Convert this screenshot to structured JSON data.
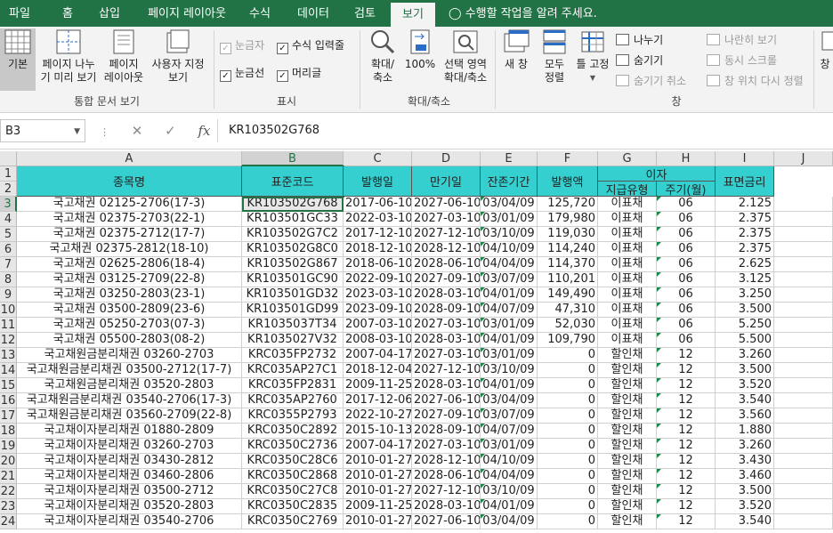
{
  "ribbon_tabs": [
    "파일",
    "홈",
    "삽입",
    "페이지 레이아웃",
    "수식",
    "데이터",
    "검토",
    "보기"
  ],
  "active_tab": "보기",
  "tell_me": "수행할 작업을 알려 주세요.",
  "ribbon": {
    "views": {
      "normal": "기본",
      "page_break": [
        "페이지 나누",
        "기 미리 보기"
      ],
      "page_layout": [
        "페이지",
        "레이아웃"
      ],
      "custom": [
        "사용자 지정",
        "보기"
      ],
      "label": "통합 문서 보기"
    },
    "show": {
      "ruler": "눈금자",
      "formula_bar": "수식 입력줄",
      "gridlines": "눈금선",
      "headings": "머리글",
      "label": "표시"
    },
    "zoom": {
      "zoom": [
        "확대/",
        "축소"
      ],
      "zoom100": "100%",
      "zoom_sel": [
        "선택 영역",
        "확대/축소"
      ],
      "label": "확대/축소"
    },
    "window": {
      "new_window": "새 창",
      "arrange_all": [
        "모두",
        "정렬"
      ],
      "freeze": "틀 고정",
      "split": "나누기",
      "hide": "숨기기",
      "unhide": "숨기기 취소",
      "side_by_side": "나란히 보기",
      "sync_scroll": "동시 스크롤",
      "reset_pos": "창 위치 다시 정렬",
      "switch": "창",
      "label": "창"
    }
  },
  "formula_bar": {
    "name_box": "B3",
    "formula": "KR103502G768"
  },
  "columns": [
    "A",
    "B",
    "C",
    "D",
    "E",
    "F",
    "G",
    "H",
    "I",
    "J"
  ],
  "headers": {
    "A": "종목명",
    "B": "표준코드",
    "C": "발행일",
    "D": "만기일",
    "E": "잔존기간",
    "F": "발행액",
    "interest": "이자",
    "G": "지급유형",
    "H": "주기(월)",
    "I": "표면금리"
  },
  "rows": [
    {
      "n": "3",
      "a": "국고채권 02125-2706(17-3)",
      "b": "KR103502G768",
      "c": "2017-06-10",
      "d": "2027-06-10",
      "e": "03/04/09",
      "f": "125,720",
      "g": "이표채",
      "h": "06",
      "i": "2.125"
    },
    {
      "n": "4",
      "a": "국고채권 02375-2703(22-1)",
      "b": "KR103501GC33",
      "c": "2022-03-10",
      "d": "2027-03-10",
      "e": "03/01/09",
      "f": "179,980",
      "g": "이표채",
      "h": "06",
      "i": "2.375"
    },
    {
      "n": "5",
      "a": "국고채권 02375-2712(17-7)",
      "b": "KR103502G7C2",
      "c": "2017-12-10",
      "d": "2027-12-10",
      "e": "03/10/09",
      "f": "119,030",
      "g": "이표채",
      "h": "06",
      "i": "2.375"
    },
    {
      "n": "6",
      "a": "국고채권 02375-2812(18-10)",
      "b": "KR103502G8C0",
      "c": "2018-12-10",
      "d": "2028-12-10",
      "e": "04/10/09",
      "f": "114,240",
      "g": "이표채",
      "h": "06",
      "i": "2.375"
    },
    {
      "n": "7",
      "a": "국고채권 02625-2806(18-4)",
      "b": "KR103502G867",
      "c": "2018-06-10",
      "d": "2028-06-10",
      "e": "04/04/09",
      "f": "114,370",
      "g": "이표채",
      "h": "06",
      "i": "2.625"
    },
    {
      "n": "8",
      "a": "국고채권 03125-2709(22-8)",
      "b": "KR103501GC90",
      "c": "2022-09-10",
      "d": "2027-09-10",
      "e": "03/07/09",
      "f": "110,201",
      "g": "이표채",
      "h": "06",
      "i": "3.125"
    },
    {
      "n": "9",
      "a": "국고채권 03250-2803(23-1)",
      "b": "KR103501GD32",
      "c": "2023-03-10",
      "d": "2028-03-10",
      "e": "04/01/09",
      "f": "149,490",
      "g": "이표채",
      "h": "06",
      "i": "3.250"
    },
    {
      "n": "10",
      "a": "국고채권 03500-2809(23-6)",
      "b": "KR103501GD99",
      "c": "2023-09-10",
      "d": "2028-09-10",
      "e": "04/07/09",
      "f": "47,310",
      "g": "이표채",
      "h": "06",
      "i": "3.500"
    },
    {
      "n": "11",
      "a": "국고채권 05250-2703(07-3)",
      "b": "KR1035037T34",
      "c": "2007-03-10",
      "d": "2027-03-10",
      "e": "03/01/09",
      "f": "52,030",
      "g": "이표채",
      "h": "06",
      "i": "5.250"
    },
    {
      "n": "12",
      "a": "국고채권 05500-2803(08-2)",
      "b": "KR1035027V32",
      "c": "2008-03-10",
      "d": "2028-03-10",
      "e": "04/01/09",
      "f": "109,790",
      "g": "이표채",
      "h": "06",
      "i": "5.500"
    },
    {
      "n": "13",
      "a": "국고채원금분리채권 03260-2703",
      "b": "KRC035FP2732",
      "c": "2007-04-17",
      "d": "2027-03-10",
      "e": "03/01/09",
      "f": "0",
      "g": "할인채",
      "h": "12",
      "i": "3.260"
    },
    {
      "n": "14",
      "a": "국고채원금분리채권 03500-2712(17-7)",
      "b": "KRC035AP27C1",
      "c": "2018-12-04",
      "d": "2027-12-10",
      "e": "03/10/09",
      "f": "0",
      "g": "할인채",
      "h": "12",
      "i": "3.500"
    },
    {
      "n": "15",
      "a": "국고채원금분리채권 03520-2803",
      "b": "KRC035FP2831",
      "c": "2009-11-25",
      "d": "2028-03-10",
      "e": "04/01/09",
      "f": "0",
      "g": "할인채",
      "h": "12",
      "i": "3.520"
    },
    {
      "n": "16",
      "a": "국고채원금분리채권 03540-2706(17-3)",
      "b": "KRC035AP2760",
      "c": "2017-12-06",
      "d": "2027-06-10",
      "e": "03/04/09",
      "f": "0",
      "g": "할인채",
      "h": "12",
      "i": "3.540"
    },
    {
      "n": "17",
      "a": "국고채원금분리채권 03560-2709(22-8)",
      "b": "KRC0355P2793",
      "c": "2022-10-27",
      "d": "2027-09-10",
      "e": "03/07/09",
      "f": "0",
      "g": "할인채",
      "h": "12",
      "i": "3.560"
    },
    {
      "n": "18",
      "a": "국고채이자분리채권 01880-2809",
      "b": "KRC0350C2892",
      "c": "2015-10-13",
      "d": "2028-09-10",
      "e": "04/07/09",
      "f": "0",
      "g": "할인채",
      "h": "12",
      "i": "1.880"
    },
    {
      "n": "19",
      "a": "국고채이자분리채권 03260-2703",
      "b": "KRC0350C2736",
      "c": "2007-04-17",
      "d": "2027-03-10",
      "e": "03/01/09",
      "f": "0",
      "g": "할인채",
      "h": "12",
      "i": "3.260"
    },
    {
      "n": "20",
      "a": "국고채이자분리채권 03430-2812",
      "b": "KRC0350C28C6",
      "c": "2010-01-27",
      "d": "2028-12-10",
      "e": "04/10/09",
      "f": "0",
      "g": "할인채",
      "h": "12",
      "i": "3.430"
    },
    {
      "n": "21",
      "a": "국고채이자분리채권 03460-2806",
      "b": "KRC0350C2868",
      "c": "2010-01-27",
      "d": "2028-06-10",
      "e": "04/04/09",
      "f": "0",
      "g": "할인채",
      "h": "12",
      "i": "3.460"
    },
    {
      "n": "22",
      "a": "국고채이자분리채권 03500-2712",
      "b": "KRC0350C27C8",
      "c": "2010-01-27",
      "d": "2027-12-10",
      "e": "03/10/09",
      "f": "0",
      "g": "할인채",
      "h": "12",
      "i": "3.500"
    },
    {
      "n": "23",
      "a": "국고채이자분리채권 03520-2803",
      "b": "KRC0350C2835",
      "c": "2009-11-25",
      "d": "2028-03-10",
      "e": "04/01/09",
      "f": "0",
      "g": "할인채",
      "h": "12",
      "i": "3.520"
    },
    {
      "n": "24",
      "a": "국고채이자분리채권 03540-2706",
      "b": "KRC0350C2769",
      "c": "2010-01-27",
      "d": "2027-06-10",
      "e": "03/04/09",
      "f": "0",
      "g": "할인채",
      "h": "12",
      "i": "3.540"
    }
  ],
  "colors": {
    "accent": "#217346",
    "header_fill": "#36cfd0"
  }
}
